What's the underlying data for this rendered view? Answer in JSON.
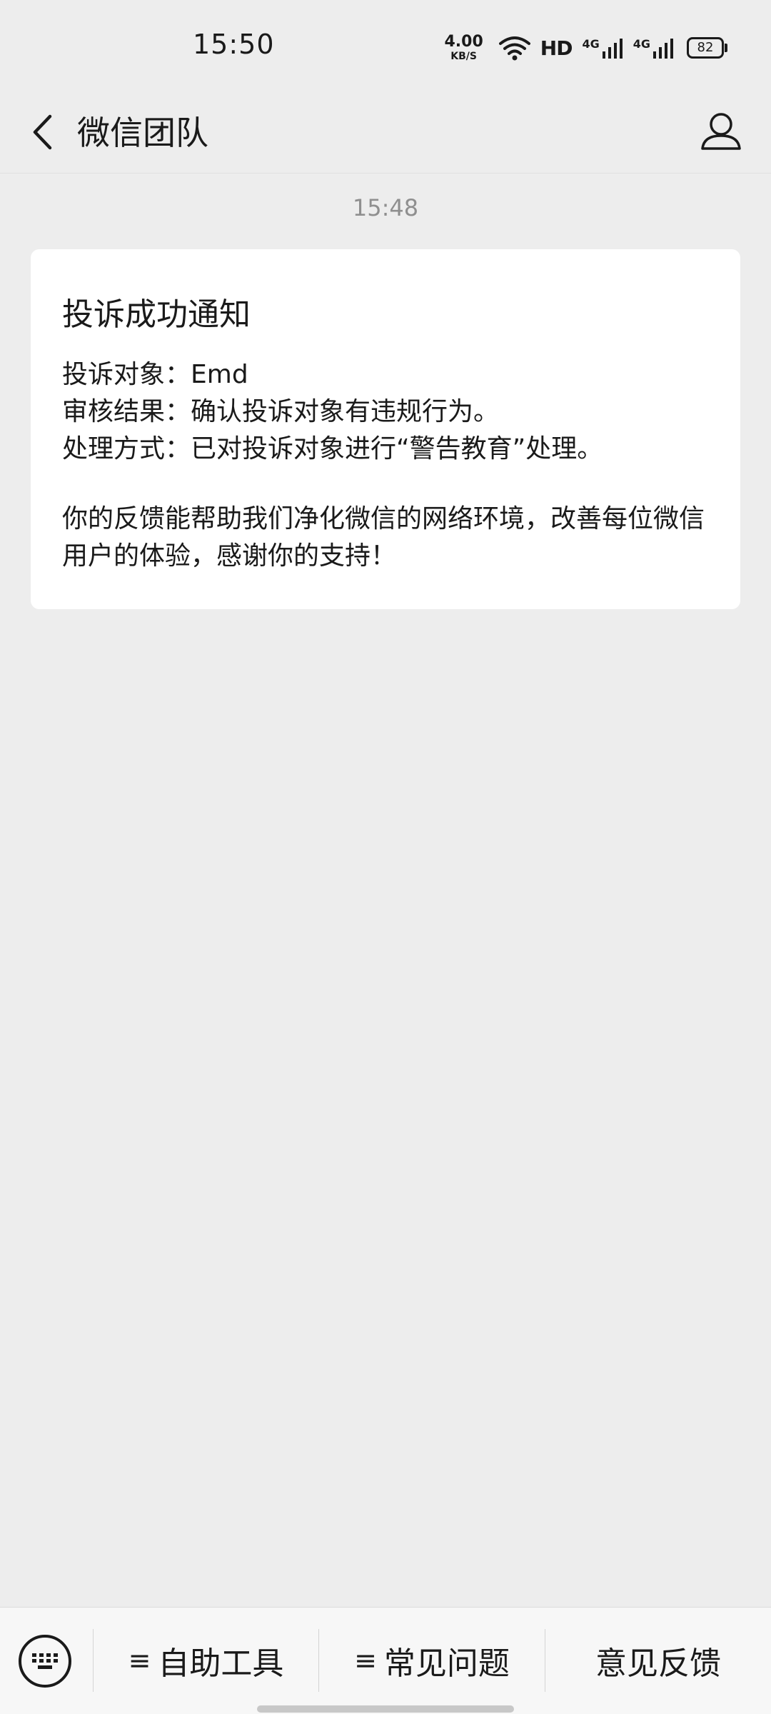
{
  "status_bar": {
    "time": "15:50",
    "net_speed_value": "4.00",
    "net_speed_unit": "KB/S",
    "hd": "HD",
    "signal_1": "4G",
    "signal_2": "4G",
    "battery_percent": "82"
  },
  "header": {
    "title": "微信团队"
  },
  "messages": {
    "timestamp": "15:48",
    "card": {
      "title": "投诉成功通知",
      "details": [
        "投诉对象：Emd",
        "审核结果：确认投诉对象有违规行为。",
        "处理方式：已对投诉对象进行“警告教育”处理。"
      ],
      "body": "你的反馈能帮助我们净化微信的网络环境，改善每位微信用户的体验，感谢你的支持！"
    }
  },
  "bottom_menu": {
    "items": [
      {
        "icon": "≡",
        "label": "自助工具"
      },
      {
        "icon": "≡",
        "label": "常见问题"
      },
      {
        "icon": "",
        "label": "意见反馈"
      }
    ]
  },
  "colors": {
    "background": "#ededed",
    "card": "#ffffff",
    "timestamp": "#8f8f8f",
    "bottom_bar": "#f7f7f7"
  }
}
